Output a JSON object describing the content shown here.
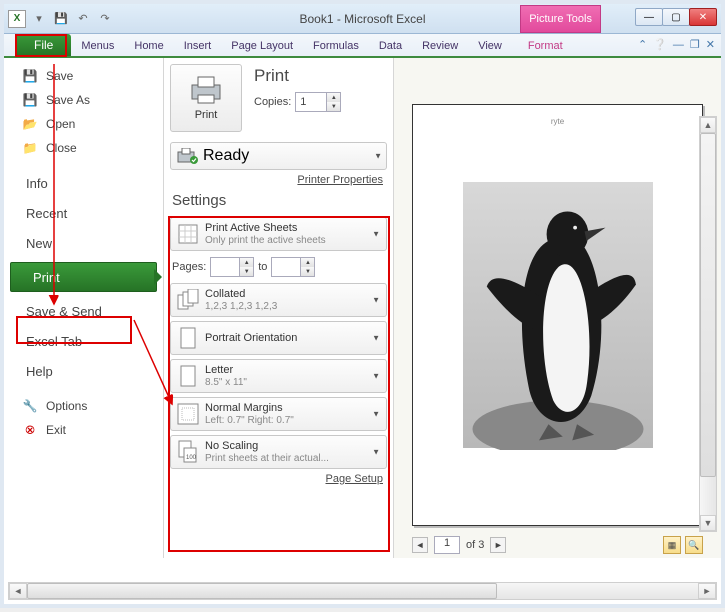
{
  "titlebar": {
    "title": "Book1 - Microsoft Excel",
    "context_tab": "Picture Tools"
  },
  "ribbon": {
    "file": "File",
    "tabs": [
      "Menus",
      "Home",
      "Insert",
      "Page Layout",
      "Formulas",
      "Data",
      "Review",
      "View",
      "Format"
    ]
  },
  "backstage_left": {
    "save": "Save",
    "save_as": "Save As",
    "open": "Open",
    "close": "Close",
    "info": "Info",
    "recent": "Recent",
    "new": "New",
    "print": "Print",
    "save_send": "Save & Send",
    "excel_tab": "Excel Tab",
    "help": "Help",
    "options": "Options",
    "exit": "Exit"
  },
  "print_panel": {
    "heading": "Print",
    "print_btn": "Print",
    "copies_label": "Copies:",
    "copies_value": "1",
    "ready": "Ready",
    "printer_properties": "Printer Properties",
    "settings_heading": "Settings",
    "active_sheets": {
      "t1": "Print Active Sheets",
      "t2": "Only print the active sheets"
    },
    "pages_label": "Pages:",
    "pages_from": "",
    "to_label": "to",
    "pages_to": "",
    "collated": {
      "t1": "Collated",
      "t2": "1,2,3   1,2,3   1,2,3"
    },
    "orientation": {
      "t1": "Portrait Orientation"
    },
    "letter": {
      "t1": "Letter",
      "t2": "8.5\" x 11\""
    },
    "margins": {
      "t1": "Normal Margins",
      "t2": "Left: 0.7\"   Right: 0.7\""
    },
    "scaling": {
      "t1": "No Scaling",
      "t2": "Print sheets at their actual..."
    },
    "page_setup": "Page Setup"
  },
  "preview": {
    "caption": "ryte",
    "nav": {
      "page": "1",
      "of_label": "of 3"
    }
  }
}
